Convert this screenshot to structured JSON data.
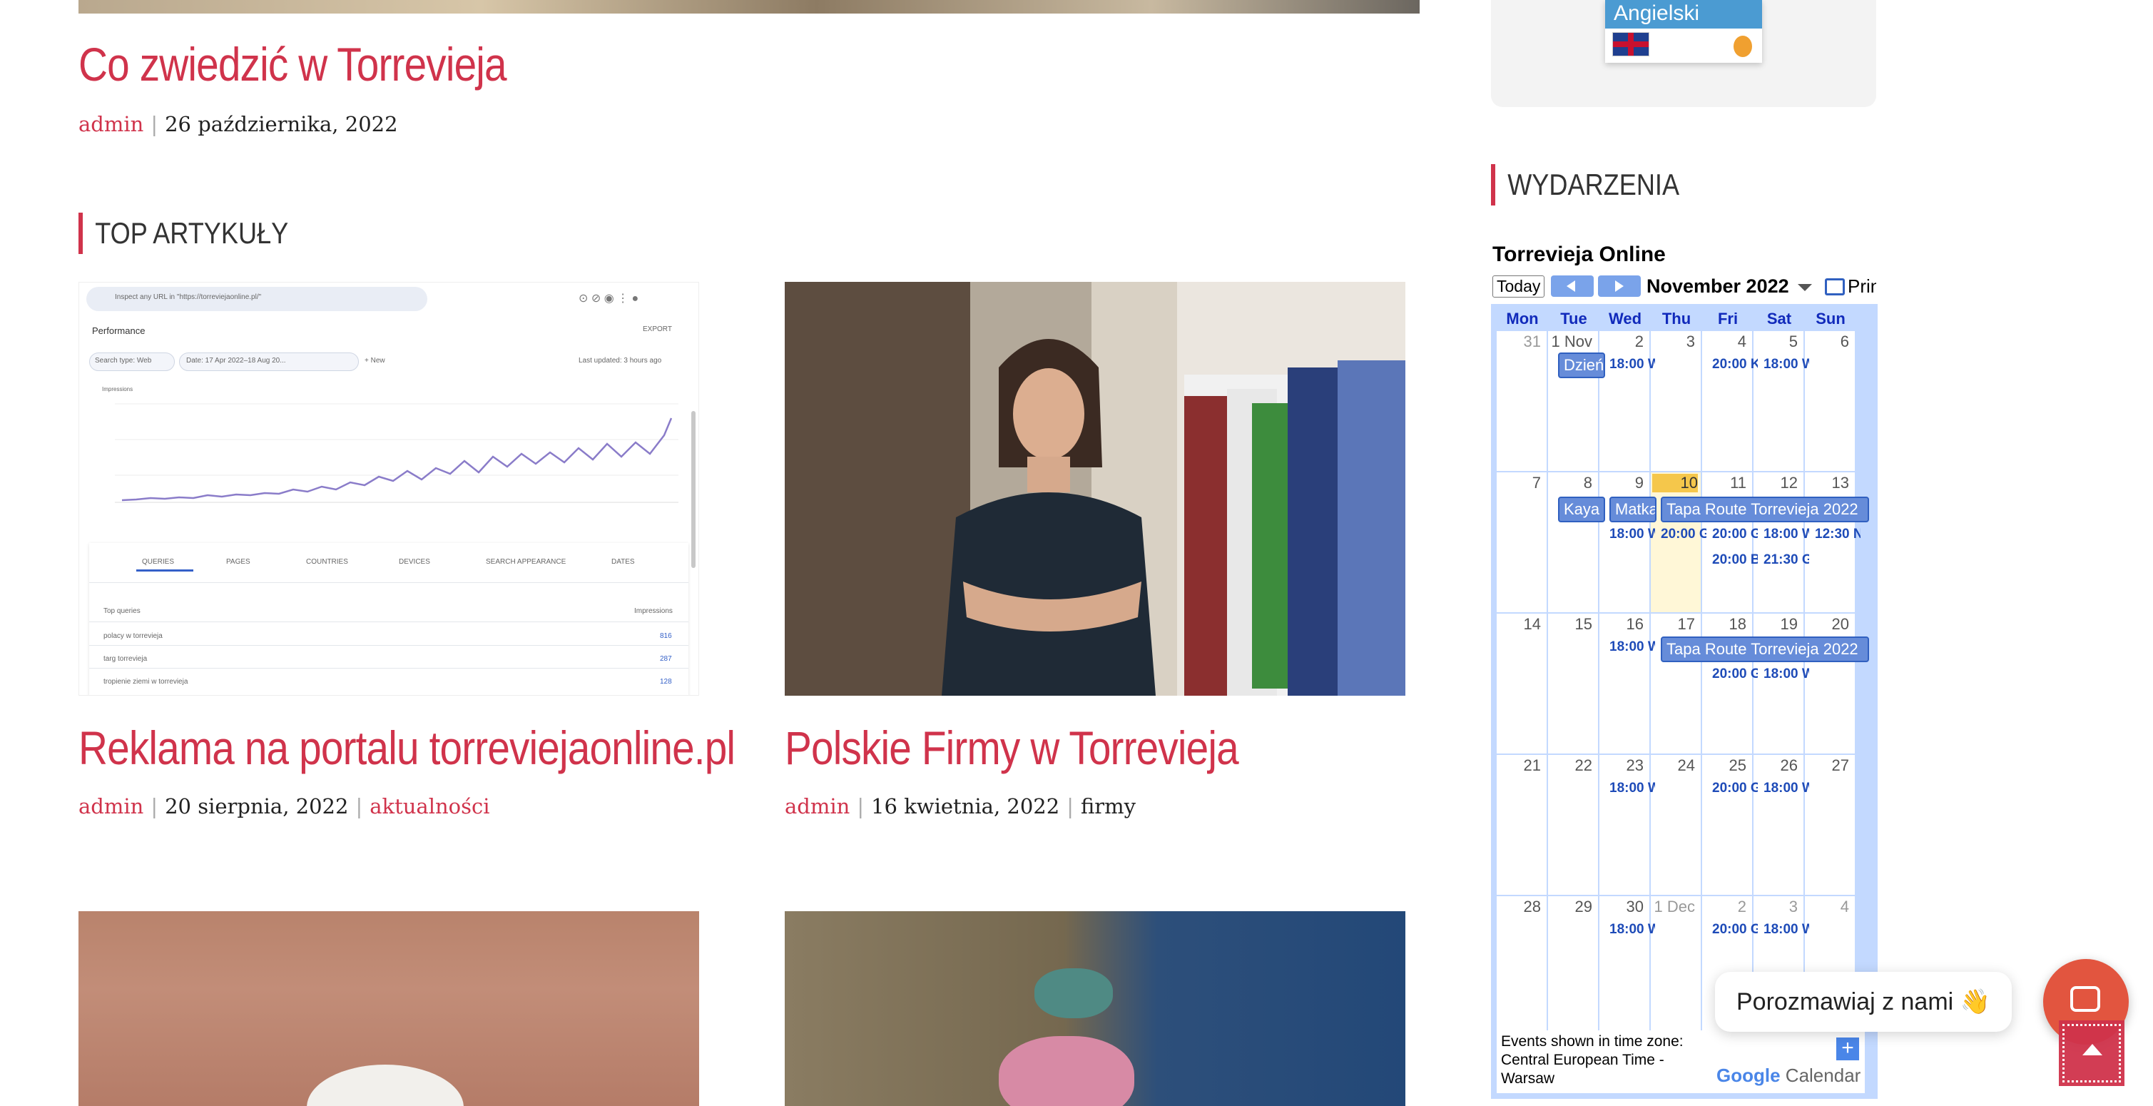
{
  "top_article": {
    "title": "Co zwiedzić w Torrevieja",
    "author": "admin",
    "date": "26 października, 2022"
  },
  "section_title": "TOP ARTYKUŁY",
  "articles": [
    {
      "title": "Reklama na portalu torreviejaonline.pl",
      "author": "admin",
      "date": "20 sierpnia, 2022",
      "category": "aktualności"
    },
    {
      "title": "Polskie Firmy w Torrevieja",
      "author": "admin",
      "date": "16 kwietnia, 2022",
      "category": "firmy"
    }
  ],
  "gsc_screenshot": {
    "search_placeholder": "Inspect any URL in \"https://torreviejaonline.pl/\"",
    "heading": "Performance",
    "export": "EXPORT",
    "chip1": "Search type: Web",
    "chip2": "Date: 17 Apr 2022–18 Aug 20...",
    "new": "+ New",
    "last_updated": "Last updated: 3 hours ago",
    "series_label": "Impressions",
    "tabs": [
      "QUERIES",
      "PAGES",
      "COUNTRIES",
      "DEVICES",
      "SEARCH APPEARANCE",
      "DATES"
    ],
    "col_left": "Top queries",
    "col_right": "Impressions",
    "rows": [
      {
        "q": "polacy w torrevieja",
        "v": "816"
      },
      {
        "q": "targ torrevieja",
        "v": "287"
      },
      {
        "q": "tropienie ziemi w torrevieja",
        "v": "128"
      }
    ]
  },
  "sidebar": {
    "ad_label": "Angielski",
    "events_title": "WYDARZENIA",
    "calendar": {
      "name": "Torrevieja Online",
      "today": "Today",
      "month": "November 2022",
      "print": "Print",
      "weekdays": [
        "Mon",
        "Tue",
        "Wed",
        "Thu",
        "Fri",
        "Sat",
        "Sun"
      ],
      "weeks": [
        [
          "31",
          "1 Nov",
          "2",
          "3",
          "4",
          "5",
          "6"
        ],
        [
          "7",
          "8",
          "9",
          "10",
          "11",
          "12",
          "13"
        ],
        [
          "14",
          "15",
          "16",
          "17",
          "18",
          "19",
          "20"
        ],
        [
          "21",
          "22",
          "23",
          "24",
          "25",
          "26",
          "27"
        ],
        [
          "28",
          "29",
          "30",
          "1 Dec",
          "2",
          "3",
          "4"
        ]
      ],
      "events": {
        "w1_tue": "Dzień",
        "w1_wed": "18:00 W",
        "w1_fri": "20:00 K",
        "w1_sat": "18:00 W",
        "w2_tue": "Kaya",
        "w2_wed": "Matka",
        "w2_tapa": "Tapa Route Torrevieja 2022",
        "w2_wed2": "18:00 W",
        "w2_thu": "20:00 G",
        "w2_fri": "20:00 G",
        "w2_sat": "18:00 W",
        "w2_sun": "12:30 N",
        "w2_fri2": "20:00 B",
        "w2_sat2": "21:30 G",
        "w3_wed": "18:00 W",
        "w3_tapa": "Tapa Route Torrevieja 2022",
        "w3_fri": "20:00 G",
        "w3_sat": "18:00 W",
        "w4_wed": "18:00 W",
        "w4_fri": "20:00 G",
        "w4_sat": "18:00 W",
        "w5_wed": "18:00 W",
        "w5_fri": "20:00 G",
        "w5_sat": "18:00 W"
      },
      "timezone_line1": "Events shown in time zone:",
      "timezone_line2": "Central European Time -",
      "timezone_line3": "Warsaw",
      "brand_google": "Google",
      "brand_calendar": "Calendar"
    }
  },
  "chat": {
    "label": "Porozmawiaj z nami",
    "emoji": "👋"
  },
  "colors": {
    "accent": "#d0334b",
    "calendar_border": "#c3d9ff",
    "today_bg": "#fff7d7",
    "event_blue": "#668cd9"
  }
}
